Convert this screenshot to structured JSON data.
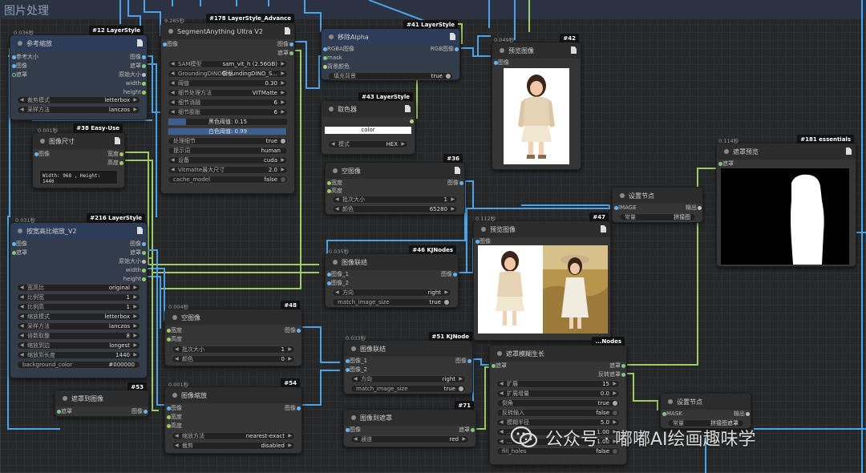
{
  "group": {
    "title": "图片处理"
  },
  "colors": {
    "image": "#64b5f6",
    "mask": "#81c784",
    "link": "#9ccc65"
  },
  "nodes": {
    "n12": {
      "badge": "#12 LayerStyle",
      "time": "0.036秒",
      "title": "参考缩放",
      "in": [
        "参考大小",
        "图像",
        "遮罩"
      ],
      "out": [
        "图像",
        "遮罩",
        "原始大小",
        "width",
        "height"
      ],
      "widgets": [
        {
          "label": "裁剪模式",
          "value": "letterbox"
        },
        {
          "label": "采样方法",
          "value": "lanczos"
        }
      ]
    },
    "n178": {
      "badge": "#178 LayerStyle_Advance",
      "time": "9.285秒",
      "title": "SegmentAnything Ultra V2",
      "in": [
        "图像"
      ],
      "out": [
        "图像",
        "遮罩"
      ],
      "widgets": [
        {
          "label": "SAM模型",
          "value": "sam_vit_h (2.56GB)"
        },
        {
          "label": "GroundingDINO模型",
          "value": "GroundingDINO_S..."
        },
        {
          "label": "阈值",
          "value": "0.30"
        },
        {
          "label": "细节处理方法",
          "value": "VITMatte"
        },
        {
          "label": "细节消融",
          "value": "6"
        },
        {
          "label": "细节膨胀",
          "value": "6"
        }
      ],
      "bars": [
        "黑色阈值: 0.15",
        "白色阈值: 0.99"
      ],
      "widgets2": [
        {
          "label": "处理细节",
          "value": "true"
        },
        {
          "label": "提示词",
          "value": "human"
        },
        {
          "label": "设备",
          "value": "cuda"
        },
        {
          "label": "Vitmatte最大尺寸",
          "value": "2.0"
        },
        {
          "label": "cache_model",
          "value": "false"
        }
      ]
    },
    "n41": {
      "badge": "#41 LayerStyle",
      "title": "移除Alpha",
      "in": [
        "RGBA图像",
        "mask",
        "背景颜色"
      ],
      "out": [
        "RGB图像"
      ],
      "widgets": [
        {
          "label": "填充背景",
          "value": "true"
        }
      ]
    },
    "n43": {
      "badge": "#43 LayerStyle",
      "title": "取色器",
      "color_label": "color",
      "widgets": [
        {
          "label": "模式",
          "value": "HEX"
        }
      ]
    },
    "n42": {
      "badge": "#42",
      "time": "0.049秒",
      "title": "预览图像",
      "in": [
        "图像"
      ]
    },
    "n38": {
      "badge": "#38 Easy-Use",
      "time": "0.001秒",
      "title": "图像尺寸",
      "in": [
        "图像"
      ],
      "out": [
        "宽度",
        "高度"
      ],
      "text": "Width: 968 , Height: 1440"
    },
    "n36": {
      "badge": "#36",
      "title": "空图像",
      "in": [
        "宽度",
        "高度"
      ],
      "out": [
        "图像"
      ],
      "widgets": [
        {
          "label": "批次大小",
          "value": "1"
        },
        {
          "label": "颜色",
          "value": "65280"
        }
      ]
    },
    "n216": {
      "badge": "#216 LayerStyle",
      "time": "0.031秒",
      "title": "按宽高比缩放_V2",
      "in": [
        "图像",
        "遮罩"
      ],
      "out": [
        "图像",
        "遮罩",
        "原始大小",
        "width",
        "height"
      ],
      "widgets": [
        {
          "label": "宽高比",
          "value": "original"
        },
        {
          "label": "比例宽",
          "value": "1"
        },
        {
          "label": "比例高",
          "value": "1"
        },
        {
          "label": "缩放模式",
          "value": "letterbox"
        },
        {
          "label": "采样方法",
          "value": "lanczos"
        },
        {
          "label": "倍数取整",
          "value": "8"
        },
        {
          "label": "缩放到边",
          "value": "longest"
        },
        {
          "label": "缩放到长度",
          "value": "1440"
        }
      ],
      "bg": {
        "label": "background_color",
        "value": "#000000"
      }
    },
    "n47": {
      "badge": "#47",
      "time": "0.112秒",
      "title": "预览图像",
      "in": [
        "图像"
      ]
    },
    "n46": {
      "badge": "#46 KJNodes",
      "time": "0.035秒",
      "title": "图像联结",
      "in": [
        "图像_1",
        "图像_2"
      ],
      "out": [
        "图像"
      ],
      "widgets": [
        {
          "label": "方向",
          "value": "right"
        },
        {
          "label": "match_image_size",
          "value": "true"
        }
      ]
    },
    "nset1": {
      "title": "设置节点",
      "in": [
        "IMAGE"
      ],
      "out": [
        "输出"
      ],
      "const_label": "常量",
      "const_value": "拼接图"
    },
    "n181": {
      "badge": "#181 essentials",
      "time": "0.114秒",
      "title": "遮罩预览",
      "in": [
        "遮罩"
      ]
    },
    "n48": {
      "badge": "#48",
      "time": "0.004秒",
      "title": "空图像",
      "in": [
        "宽度",
        "高度"
      ],
      "out": [
        "图像"
      ],
      "widgets": [
        {
          "label": "批次大小",
          "value": "1"
        },
        {
          "label": "颜色",
          "value": "0"
        }
      ]
    },
    "n51": {
      "badge": "#51 KJNode",
      "time": "0.033秒",
      "title": "图像联结",
      "in": [
        "图像_1",
        "图像_2"
      ],
      "out": [
        "图像"
      ],
      "widgets": [
        {
          "label": "方向",
          "value": "right"
        },
        {
          "label": "match_image_size",
          "value": "true"
        }
      ]
    },
    "ngrow": {
      "badge": "...Nodes",
      "title": "遮罩模糊生长",
      "in": [
        "遮罩"
      ],
      "out": [
        "遮罩",
        "反转遮罩"
      ],
      "widgets": [
        {
          "label": "扩展",
          "value": "15"
        },
        {
          "label": "扩展增量",
          "value": "0.0"
        },
        {
          "label": "倒角",
          "value": "true"
        },
        {
          "label": "反转输入",
          "value": "false"
        },
        {
          "label": "模糊半径",
          "value": "5.0"
        },
        {
          "label": "...",
          "value": "1.00"
        },
        {
          "label": "...",
          "value": "1.00"
        },
        {
          "label": "fill_holes",
          "value": "false"
        }
      ]
    },
    "n53": {
      "badge": "#53",
      "title": "遮罩到图像",
      "in": [
        "遮罩"
      ],
      "out": [
        "图像"
      ]
    },
    "n54": {
      "badge": "#54",
      "time": "0.001秒",
      "title": "图像缩放",
      "in": [
        "图像",
        "宽度",
        "高度"
      ],
      "out": [
        "图像"
      ],
      "widgets": [
        {
          "label": "缩放方法",
          "value": "nearest-exact"
        },
        {
          "label": "裁剪",
          "value": "disabled"
        }
      ]
    },
    "n71": {
      "badge": "#71",
      "title": "图像到遮罩",
      "in": [
        "图像"
      ],
      "out": [
        "遮罩"
      ],
      "widgets": [
        {
          "label": "通道",
          "value": "red"
        }
      ]
    },
    "nset2": {
      "title": "设置节点",
      "in": [
        "MASK"
      ],
      "out": [
        "输出"
      ],
      "const_label": "常量",
      "const_value": "拼接图遮罩"
    }
  },
  "watermark": {
    "text": "公众号 · 嘟嘟AI绘画趣味学"
  }
}
